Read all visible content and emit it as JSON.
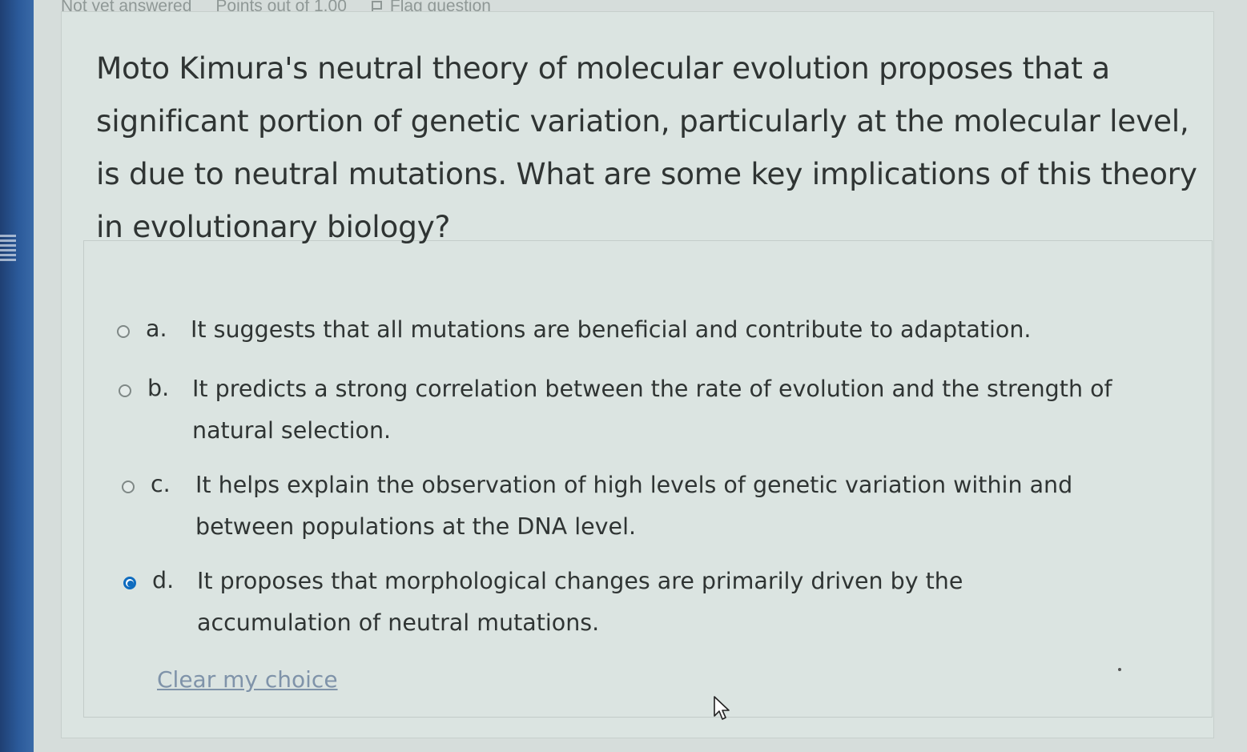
{
  "header": {
    "state": "Not yet answered",
    "points": "Points out of 1.00",
    "flag_label": "Flag question"
  },
  "question": {
    "text": "Moto Kimura's neutral theory of molecular evolution proposes that a significant portion of genetic variation, particularly at the molecular level, is due to neutral mutations. What are some key implications of this theory in evolutionary biology?"
  },
  "answers": [
    {
      "letter": "a.",
      "text": "It suggests that all mutations are beneficial and contribute to adaptation.",
      "selected": false
    },
    {
      "letter": "b.",
      "text": "It predicts a strong correlation between the rate of evolution and the strength of natural selection.",
      "selected": false
    },
    {
      "letter": "c.",
      "text": "It helps explain the observation of high levels of genetic variation within and between populations at the DNA level.",
      "selected": false
    },
    {
      "letter": "d.",
      "text": "It proposes that morphological changes are primarily driven by the accumulation of neutral mutations.",
      "selected": true
    }
  ],
  "clear_choice_label": "Clear my choice",
  "colors": {
    "accent": "#0f6cbf",
    "link": "#7f93a9",
    "text": "#2f3433"
  }
}
